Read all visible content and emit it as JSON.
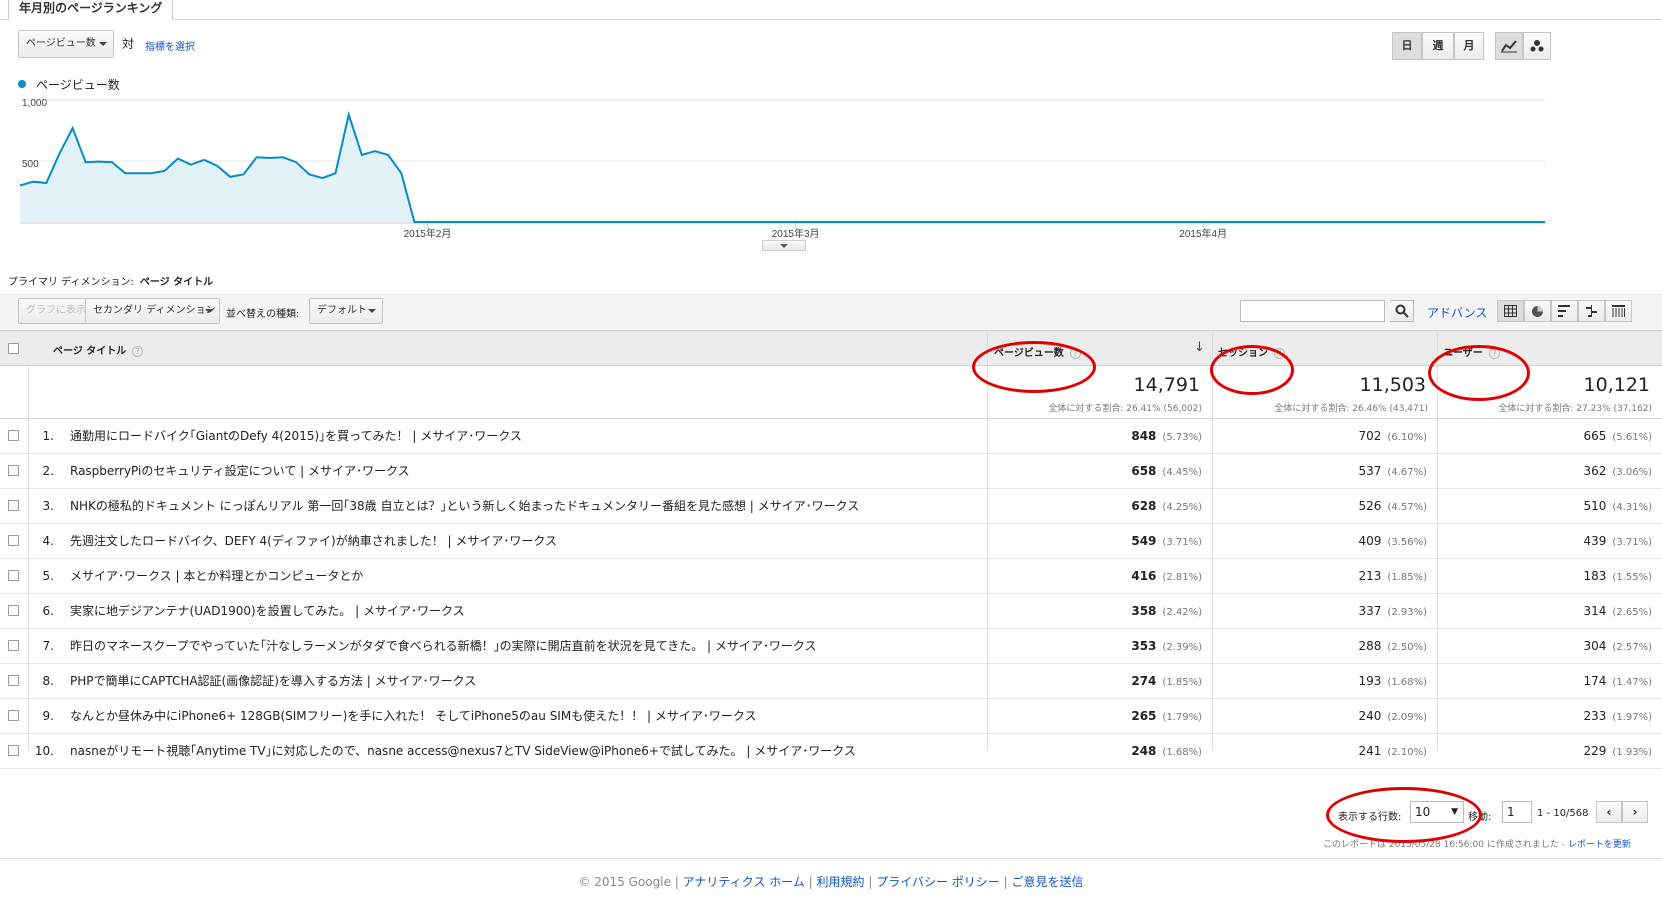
{
  "tab": {
    "title": "年月別のページランキング"
  },
  "metric_bar": {
    "primary_metric": "ページビュー数",
    "vs_label": "対",
    "select_metric_link": "指標を選択",
    "granularity": [
      "日",
      "週",
      "月"
    ],
    "active_granularity": "日"
  },
  "legend": {
    "series_name": "ページビュー数"
  },
  "chart_data": {
    "type": "area",
    "y_tick_labels": [
      "1,000",
      "500"
    ],
    "x_tick_labels": [
      "2015年2月",
      "2015年3月",
      "2015年4月"
    ],
    "ylim": [
      0,
      1000
    ],
    "grid": true,
    "series": [
      {
        "name": "ページビュー数",
        "color": "#058dc7",
        "fill": "#e3f1f9",
        "values": [
          300,
          330,
          320,
          560,
          770,
          490,
          495,
          490,
          400,
          400,
          400,
          420,
          520,
          470,
          510,
          460,
          370,
          390,
          530,
          525,
          530,
          490,
          390,
          360,
          400,
          880,
          550,
          580,
          550,
          400,
          0,
          0,
          0,
          0,
          0,
          0,
          0,
          0,
          0,
          0,
          0,
          0,
          0,
          0,
          0,
          0,
          0,
          0,
          0,
          0,
          0,
          0,
          0,
          0,
          0,
          0,
          0,
          0,
          0,
          0,
          0,
          0,
          0,
          0,
          0,
          0,
          0,
          0,
          0,
          0,
          0,
          0,
          0,
          0,
          0,
          0,
          0,
          0,
          0,
          0,
          0,
          0,
          0,
          0,
          0,
          0,
          0,
          0,
          0,
          0,
          0,
          0,
          0,
          0,
          0,
          0,
          0,
          0,
          0,
          0,
          0,
          0,
          0,
          0,
          0,
          0,
          0,
          0,
          0,
          0,
          0,
          0,
          0,
          0,
          0,
          0,
          0
        ]
      }
    ]
  },
  "dimension": {
    "label": "プライマリ ディメンション:",
    "value": "ページ タイトル"
  },
  "toolbar": {
    "plot_rows": "グラフに表示",
    "secondary_dimension": "セカンダリ ディメンション",
    "sort_type_label": "並べ替えの種類:",
    "sort_type_value": "デフォルト",
    "advanced": "アドバンス"
  },
  "table": {
    "headers": {
      "page_title": "ページ タイトル",
      "pageviews": "ページビュー数",
      "sessions": "セッション",
      "users": "ユーザー"
    },
    "totals": {
      "pageviews": {
        "value": "14,791",
        "sub": "全体に対する割合: 26.41% (56,002)"
      },
      "sessions": {
        "value": "11,503",
        "sub": "全体に対する割合: 26.46% (43,471)"
      },
      "users": {
        "value": "10,121",
        "sub": "全体に対する割合: 27.23% (37,162)"
      }
    },
    "rows": [
      {
        "num": "1.",
        "title": "通勤用にロードバイク｢GiantのDefy 4(2015)｣を買ってみた！ | メサイア･ワークス",
        "pv": "848",
        "pv_pct": "(5.73%)",
        "ses": "702",
        "ses_pct": "(6.10%)",
        "usr": "665",
        "usr_pct": "(5.61%)"
      },
      {
        "num": "2.",
        "title": "RaspberryPiのセキュリティ設定について | メサイア･ワークス",
        "pv": "658",
        "pv_pct": "(4.45%)",
        "ses": "537",
        "ses_pct": "(4.67%)",
        "usr": "362",
        "usr_pct": "(3.06%)"
      },
      {
        "num": "3.",
        "title": "NHKの極私的ドキュメント にっぽんリアル 第一回｢38歳 自立とは？｣という新しく始まったドキュメンタリー番組を見た感想 | メサイア･ワークス",
        "pv": "628",
        "pv_pct": "(4.25%)",
        "ses": "526",
        "ses_pct": "(4.57%)",
        "usr": "510",
        "usr_pct": "(4.31%)"
      },
      {
        "num": "4.",
        "title": "先週注文したロードバイク、DEFY 4(ディファイ)が納車されました！ | メサイア･ワークス",
        "pv": "549",
        "pv_pct": "(3.71%)",
        "ses": "409",
        "ses_pct": "(3.56%)",
        "usr": "439",
        "usr_pct": "(3.71%)"
      },
      {
        "num": "5.",
        "title": "メサイア･ワークス | 本とか料理とかコンピュータとか",
        "pv": "416",
        "pv_pct": "(2.81%)",
        "ses": "213",
        "ses_pct": "(1.85%)",
        "usr": "183",
        "usr_pct": "(1.55%)"
      },
      {
        "num": "6.",
        "title": "実家に地デジアンテナ(UAD1900)を設置してみた。 | メサイア･ワークス",
        "pv": "358",
        "pv_pct": "(2.42%)",
        "ses": "337",
        "ses_pct": "(2.93%)",
        "usr": "314",
        "usr_pct": "(2.65%)"
      },
      {
        "num": "7.",
        "title": "昨日のマネースクープでやっていた｢汁なしラーメンがタダで食べられる新橋！｣の実際に開店直前を状況を見てきた。 | メサイア･ワークス",
        "pv": "353",
        "pv_pct": "(2.39%)",
        "ses": "288",
        "ses_pct": "(2.50%)",
        "usr": "304",
        "usr_pct": "(2.57%)"
      },
      {
        "num": "8.",
        "title": "PHPで簡単にCAPTCHA認証(画像認証)を導入する方法 | メサイア･ワークス",
        "pv": "274",
        "pv_pct": "(1.85%)",
        "ses": "193",
        "ses_pct": "(1.68%)",
        "usr": "174",
        "usr_pct": "(1.47%)"
      },
      {
        "num": "9.",
        "title": "なんとか昼休み中にiPhone6+ 128GB(SIMフリー)を手に入れた！ そしてiPhone5のau SIMも使えた！！ | メサイア･ワークス",
        "pv": "265",
        "pv_pct": "(1.79%)",
        "ses": "240",
        "ses_pct": "(2.09%)",
        "usr": "233",
        "usr_pct": "(1.97%)"
      },
      {
        "num": "10.",
        "title": "nasneがリモート視聴｢Anytime TV｣に対応したので、nasne access@nexus7とTV SideView@iPhone6+で試してみた。 | メサイア･ワークス",
        "pv": "248",
        "pv_pct": "(1.68%)",
        "ses": "241",
        "ses_pct": "(2.10%)",
        "usr": "229",
        "usr_pct": "(1.93%)"
      }
    ]
  },
  "pager": {
    "rows_label": "表示する行数:",
    "rows_value": "10",
    "goto_label": "移動:",
    "goto_value": "1",
    "range": "1 - 10/568",
    "prev": "‹",
    "next": "›"
  },
  "report_info": {
    "text": "このレポートは 2015/05/28 16:56:00 に作成されました -",
    "refresh_link": "レポートを更新"
  },
  "footer": {
    "copyright": "© 2015 Google",
    "links": [
      "アナリティクス ホーム",
      "利用規約",
      "プライバシー ポリシー",
      "ご意見を送信"
    ],
    "sep": "|"
  }
}
